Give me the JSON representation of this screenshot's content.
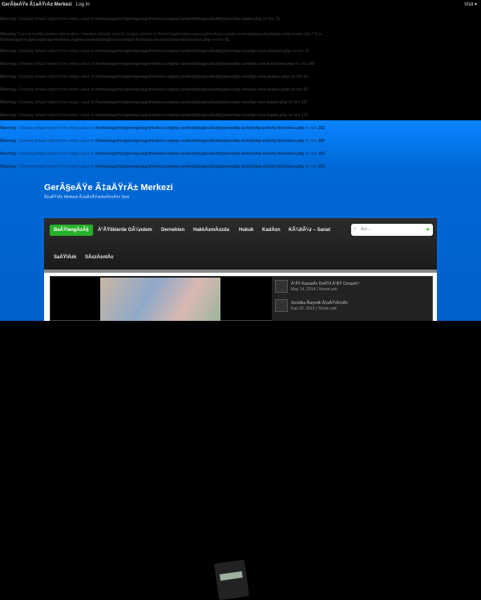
{
  "topbar": {
    "site": "GerÃ§eÄŸe Ã‡aÄŸrÄ± Merkezi",
    "login": "Log In",
    "visit": "Visit ▾"
  },
  "warnings": [
    {
      "label": "Warning",
      "msg": ": Creating default object from empty value in ",
      "file": "/home/cagrimc/gercegecagrimerkezi.org/wp-content/plugins/buddypress/bp-loader.php",
      "on": " on line ",
      "line": "71"
    },
    {
      "label": "Warning",
      "msg": ": Cannot modify header information - headers already sent by (output started at /home/cagrimc/gercegecagrimerkezi.org/wp-content/plugins/buddypress/bp-loader.php:71) in",
      "file": "/home/cagrimc/gercegecagrimerkezi.org/wp-content/plugins/si-contact-form/wp-session/class-wp-session.php",
      "on": " on line ",
      "line": "92"
    },
    {
      "label": "Warning",
      "msg": ": Creating default object from empty value in ",
      "file": "/home/cagrimc/gercegecagrimerkezi.org/wp-content/plugins/buddypress/bp-core/bp-core-catchuri.php",
      "on": " on line ",
      "line": "37"
    },
    {
      "label": "Warning",
      "msg": ": Creating default object from empty value in ",
      "file": "/home/cagrimc/gercegecagrimerkezi.org/wp-content/plugins/buddypress/bp-core/bp-core-functions.php",
      "on": " on line ",
      "line": "148"
    },
    {
      "label": "Warning",
      "msg": ": Creating default object from empty value in ",
      "file": "/home/cagrimc/gercegecagrimerkezi.org/wp-content/plugins/buddypress/bp-core/bp-core-avatars.php",
      "on": " on line ",
      "line": "52"
    },
    {
      "label": "Warning",
      "msg": ": Creating default object from empty value in ",
      "file": "/home/cagrimc/gercegecagrimerkezi.org/wp-content/plugins/buddypress/bp-core/bp-core-avatars.php",
      "on": " on line ",
      "line": "54"
    },
    {
      "label": "Warning",
      "msg": ": Creating default object from empty value in ",
      "file": "/home/cagrimc/gercegecagrimerkezi.org/wp-content/plugins/buddypress/bp-core/bp-core-loader.php",
      "on": " on line ",
      "line": "167"
    },
    {
      "label": "Warning",
      "msg": ": Creating default object from empty value in ",
      "file": "/home/cagrimc/gercegecagrimerkezi.org/wp-content/plugins/buddypress/bp-core/bp-core-loader.php",
      "on": " on line ",
      "line": "172"
    },
    {
      "label": "Warning",
      "msg": ": Creating default object from empty value in ",
      "file": "/home/cagrimc/gercegecagrimerkezi.org/wp-content/plugins/buddypress/bp-activity/bp-activity-functions.php",
      "on": " on line ",
      "line": "202"
    },
    {
      "label": "Warning",
      "msg": ": Creating default object from empty value in ",
      "file": "/home/cagrimc/gercegecagrimerkezi.org/wp-content/plugins/buddypress/bp-activity/bp-activity-functions.php",
      "on": " on line ",
      "line": "202"
    },
    {
      "label": "Warning",
      "msg": ": Creating default object from empty value in ",
      "file": "/home/cagrimc/gercegecagrimerkezi.org/wp-content/plugins/buddypress/bp-activity/bp-activity-functions.php",
      "on": " on line ",
      "line": "202"
    },
    {
      "label": "Warning",
      "msg": ": Creating default object from empty value in ",
      "file": "/home/cagrimc/gercegecagrimerkezi.org/wp-content/plugins/buddypress/bp-activity/bp-activity-functions.php",
      "on": " on line ",
      "line": "202"
    }
  ],
  "header": {
    "title": "GerÃ§eÄŸe Ã‡aÄŸrÄ± Merkezi",
    "tagline": "Ã‡aÄŸrÄ± Merkezi Ã‡alÄ±ÅŸanlarÄ±nÄ±n Sesi"
  },
  "nav": {
    "items": [
      "BaÅŸlangÄ±Ã§",
      "Ä°ÅŸliklerde GÃ¼ndem",
      "Dernekten",
      "HakkÄ±mÄ±zda",
      "Hukuk",
      "KadÄ±n",
      "KÃ¼ltÃ¼r – Sanat",
      "SaÄŸlÄ±k",
      "SÄ±zÄ±ntÄ±"
    ],
    "search_placeholder": "Ara ..."
  },
  "posts": [
    {
      "title": "Ä°ÅŸ KazasÄ± DeÄŸil Ä°ÅŸ Cinayeti !",
      "meta": "May 14, 2014 | Yorum yok"
    },
    {
      "title": "Sendika Ãœyelik Ã‡aÄŸrÄ±sÄ±",
      "meta": "Kas 20, 2013 | Yorum yok"
    }
  ]
}
